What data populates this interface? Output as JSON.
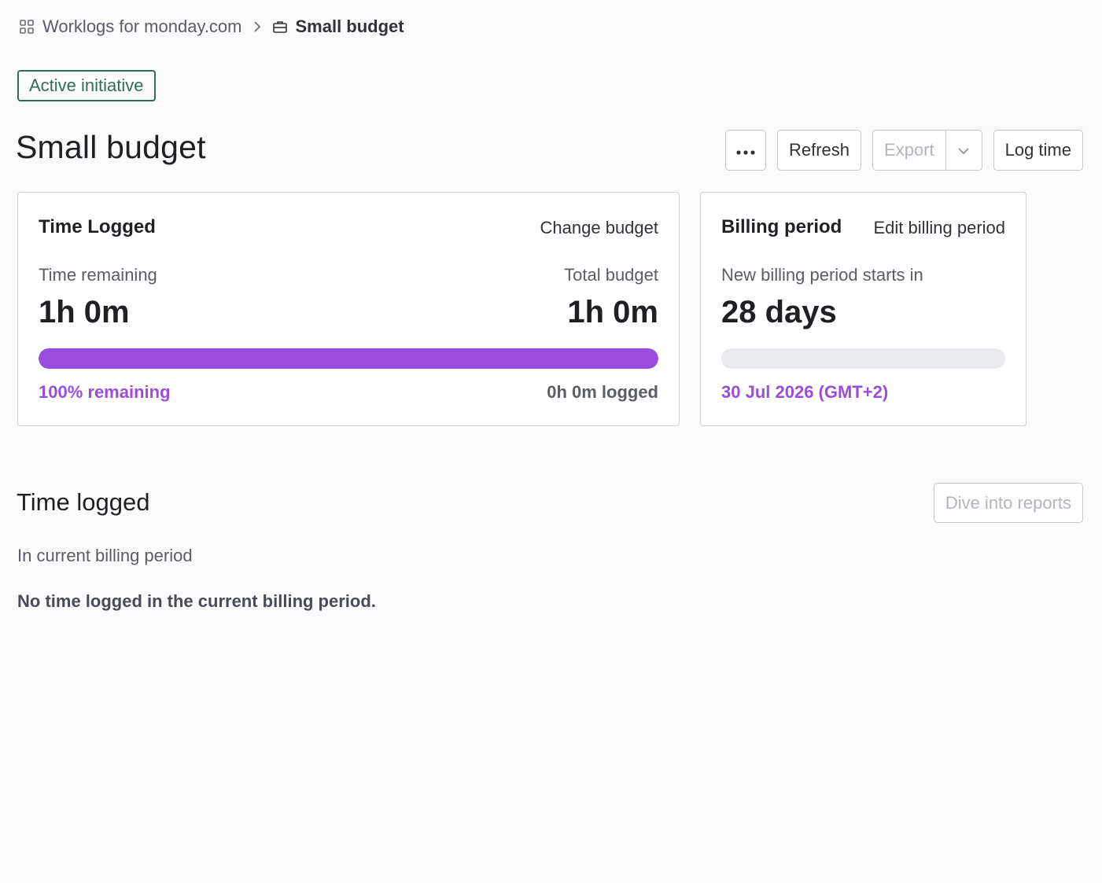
{
  "breadcrumb": {
    "app_label": "Worklogs for monday.com",
    "current_label": "Small budget"
  },
  "status_badge": "Active initiative",
  "page_title": "Small budget",
  "toolbar": {
    "more_icon": "more-horizontal-icon",
    "refresh_label": "Refresh",
    "export_label": "Export",
    "log_time_label": "Log time"
  },
  "time_card": {
    "title": "Time Logged",
    "action": "Change budget",
    "remaining_label": "Time remaining",
    "remaining_value": "1h 0m",
    "total_label": "Total budget",
    "total_value": "1h 0m",
    "progress_fraction": 1.0,
    "percent_remaining": "100% remaining",
    "logged": "0h 0m logged"
  },
  "billing_card": {
    "title": "Billing period",
    "action": "Edit billing period",
    "starts_label": "New billing period starts in",
    "days_value": "28 days",
    "progress_fraction": 0.0,
    "date": "30 Jul 2026 (GMT+2)"
  },
  "time_logged_section": {
    "title": "Time logged",
    "reports_button": "Dive into reports",
    "subtitle": "In current billing period",
    "empty_message": "No time logged in the current billing period."
  },
  "colors": {
    "accent": "#9a4ddd",
    "status_green": "#2f6f59"
  }
}
